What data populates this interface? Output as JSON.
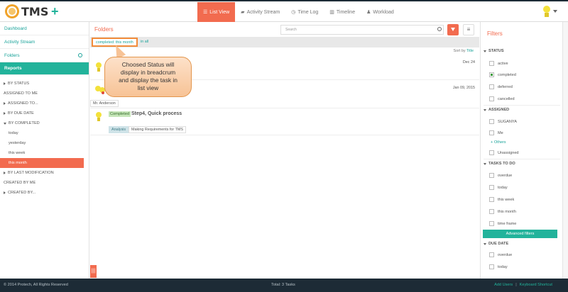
{
  "app": {
    "name": "TMS",
    "add_label": "+"
  },
  "nav": {
    "tabs": [
      {
        "label": "List View",
        "icon": "list-icon",
        "active": true
      },
      {
        "label": "Activity Stream",
        "icon": "comment-icon"
      },
      {
        "label": "Time Log",
        "icon": "clock-icon"
      },
      {
        "label": "Timeline",
        "icon": "bar-chart-icon"
      },
      {
        "label": "Workload",
        "icon": "user-icon"
      }
    ]
  },
  "sidebar": {
    "dashboard": "Dashboard",
    "activity_stream": "Activity Stream",
    "folders": "Folders",
    "reports": "Reports",
    "groups": [
      {
        "label": "BY STATUS"
      },
      {
        "label": "ASSIGNED TO ME"
      },
      {
        "label": "ASSIGNED TO..."
      },
      {
        "label": "BY DUE DATE"
      },
      {
        "label": "BY COMPLETED"
      },
      {
        "label": "today"
      },
      {
        "label": "yesterday"
      },
      {
        "label": "this week"
      },
      {
        "label": "this month"
      },
      {
        "label": "BY LAST MODIFICATION"
      },
      {
        "label": "CREATED BY ME"
      },
      {
        "label": "CREATED BY..."
      }
    ]
  },
  "main": {
    "title": "Folders",
    "search_placeholder": "Search",
    "menu_glyph": "≡",
    "breadcrumb": {
      "chip": "completed: this month",
      "sep": "in all"
    },
    "sort_label": "Sort by",
    "sort_value": "Title",
    "tasks": [
      {
        "date": "Dec 24"
      },
      {
        "date": "Jan 09, 2015",
        "assignee": "Mr. Anderson"
      },
      {
        "status": "Completed",
        "title": "Step4, Quick process",
        "tags": [
          "Analysis",
          "Making Requirements for TMS"
        ]
      }
    ]
  },
  "callout": {
    "line1": "Choosed Status will",
    "line2": "display in breadcrum",
    "line3": "and display the task in",
    "line4": "list view"
  },
  "filters": {
    "title": "Filters",
    "status": {
      "heading": "STATUS",
      "options": [
        "active",
        "completed",
        "deferred",
        "cancelled"
      ]
    },
    "assigned": {
      "heading": "ASSIGNED",
      "options": [
        "SUGANYA",
        "Me"
      ],
      "more": "+ Others",
      "unassigned": "Unassigned"
    },
    "tasks_to_do": {
      "heading": "TASKS TO DO",
      "options": [
        "overdue",
        "today",
        "this week",
        "this month",
        "time frame"
      ]
    },
    "advanced": "Advanced filters",
    "due_date": {
      "heading": "DUE DATE",
      "options": [
        "overdue",
        "today"
      ]
    }
  },
  "footer": {
    "copyright": "© 2014 Protech, All Rights Reserved",
    "total": "Total: 3 Tasks",
    "add_users": "Add Users",
    "sep": "|",
    "keyboard": "Keyboard Shortcut"
  },
  "colors": {
    "accent": "#f26b4f",
    "teal": "#22b39b",
    "dark": "#1d2b36"
  }
}
